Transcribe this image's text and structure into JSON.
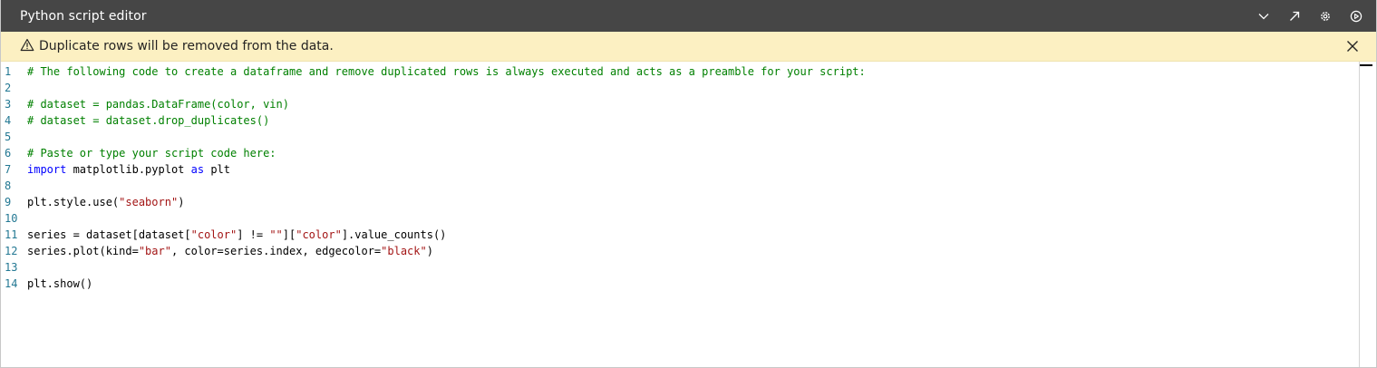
{
  "window": {
    "title": "Python script editor"
  },
  "toolbar": {
    "icons": [
      "chevron-down-icon",
      "expand-icon",
      "gear-icon",
      "run-icon"
    ]
  },
  "warning": {
    "text": "Duplicate rows will be removed from the data.",
    "icon": "warning-icon",
    "close_icon": "close-icon",
    "background": "#fcf0c2"
  },
  "colors": {
    "titlebar": "#464646",
    "comment": "#008000",
    "keyword": "#0000ff",
    "string": "#a31515",
    "line_number": "#237893"
  },
  "editor": {
    "lines": [
      {
        "n": "1",
        "tokens": [
          {
            "t": "# The following code to create a dataframe and remove duplicated rows is always executed and acts as a preamble for your script:",
            "k": "comment"
          }
        ]
      },
      {
        "n": "2",
        "tokens": []
      },
      {
        "n": "3",
        "tokens": [
          {
            "t": "# dataset = pandas.DataFrame(color, vin)",
            "k": "comment"
          }
        ]
      },
      {
        "n": "4",
        "tokens": [
          {
            "t": "# dataset = dataset.drop_duplicates()",
            "k": "comment"
          }
        ]
      },
      {
        "n": "5",
        "tokens": []
      },
      {
        "n": "6",
        "tokens": [
          {
            "t": "# Paste or type your script code here:",
            "k": "comment"
          }
        ]
      },
      {
        "n": "7",
        "tokens": [
          {
            "t": "import",
            "k": "keyword"
          },
          {
            "t": " matplotlib.pyplot ",
            "k": "plain"
          },
          {
            "t": "as",
            "k": "keyword"
          },
          {
            "t": " plt",
            "k": "plain"
          }
        ]
      },
      {
        "n": "8",
        "tokens": []
      },
      {
        "n": "9",
        "tokens": [
          {
            "t": "plt.style.use(",
            "k": "plain"
          },
          {
            "t": "\"seaborn\"",
            "k": "string"
          },
          {
            "t": ")",
            "k": "plain"
          }
        ]
      },
      {
        "n": "10",
        "tokens": []
      },
      {
        "n": "11",
        "tokens": [
          {
            "t": "series = dataset[dataset[",
            "k": "plain"
          },
          {
            "t": "\"color\"",
            "k": "string"
          },
          {
            "t": "] != ",
            "k": "plain"
          },
          {
            "t": "\"\"",
            "k": "string"
          },
          {
            "t": "][",
            "k": "plain"
          },
          {
            "t": "\"color\"",
            "k": "string"
          },
          {
            "t": "].value_counts()",
            "k": "plain"
          }
        ]
      },
      {
        "n": "12",
        "tokens": [
          {
            "t": "series.plot(kind=",
            "k": "plain"
          },
          {
            "t": "\"bar\"",
            "k": "string"
          },
          {
            "t": ", color=series.index, edgecolor=",
            "k": "plain"
          },
          {
            "t": "\"black\"",
            "k": "string"
          },
          {
            "t": ")",
            "k": "plain"
          }
        ]
      },
      {
        "n": "13",
        "tokens": []
      },
      {
        "n": "14",
        "tokens": [
          {
            "t": "plt.show()",
            "k": "plain"
          }
        ]
      }
    ]
  }
}
